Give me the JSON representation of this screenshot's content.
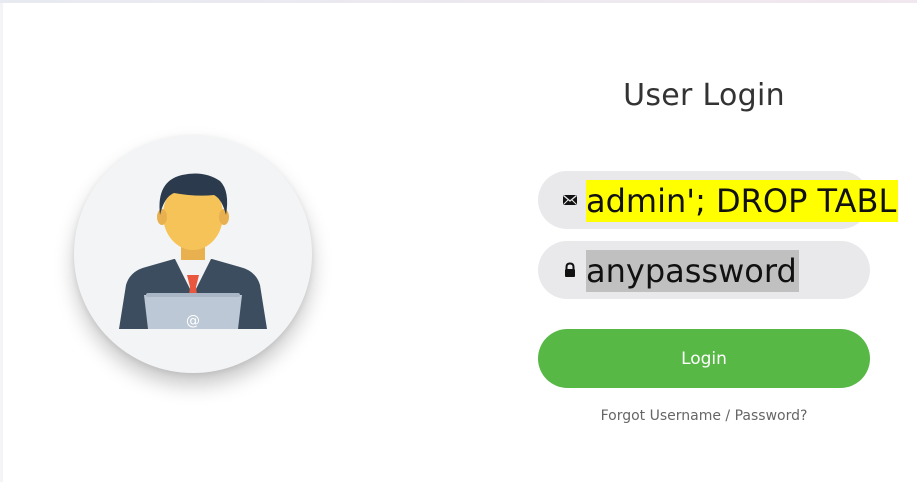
{
  "form": {
    "title": "User Login",
    "email_value": "admin'; DROP TABL",
    "password_value": "anypassword",
    "login_label": "Login",
    "forgot_label": "Forgot Username / Password?"
  },
  "icons": {
    "avatar": "user-at-laptop-icon",
    "email": "envelope-icon",
    "password": "lock-icon"
  },
  "colors": {
    "accent": "#57b846",
    "field_bg": "#e9e9ec",
    "email_highlight": "#ffff00",
    "password_highlight": "#c0c0c0",
    "avatar_bg": "#f3f4f6",
    "laptop_at_symbol": "@"
  }
}
